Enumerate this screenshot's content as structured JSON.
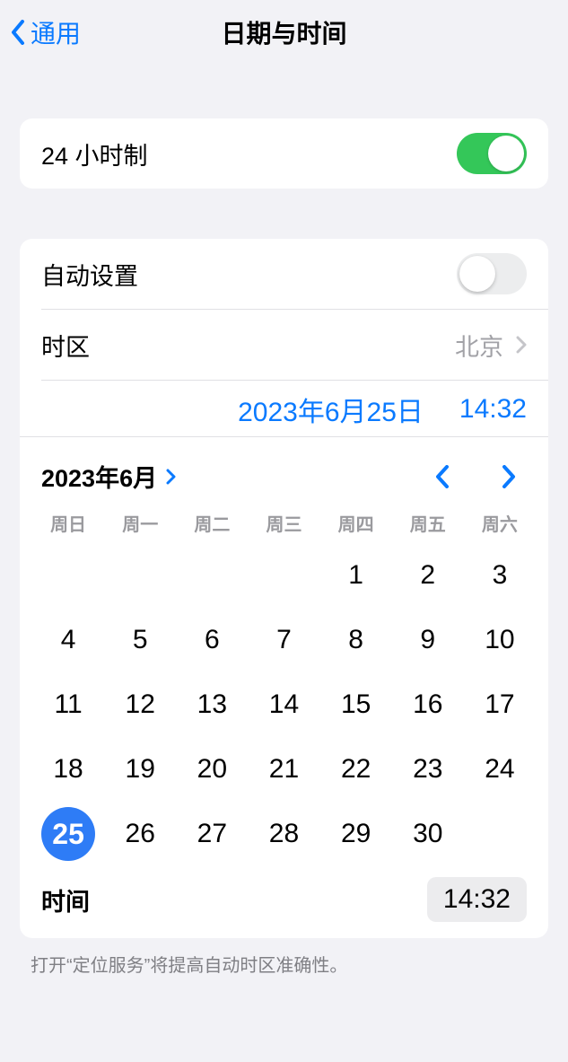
{
  "nav": {
    "back_label": "通用",
    "title": "日期与时间"
  },
  "row_24h": {
    "label": "24 小时制",
    "on": true
  },
  "row_autoset": {
    "label": "自动设置",
    "on": false
  },
  "row_timezone": {
    "label": "时区",
    "value": "北京"
  },
  "picker": {
    "date_label": "2023年6月25日",
    "time_label": "14:32"
  },
  "calendar": {
    "month_label": "2023年6月",
    "weekdays": [
      "周日",
      "周一",
      "周二",
      "周三",
      "周四",
      "周五",
      "周六"
    ],
    "leading_blanks": 4,
    "days_in_month": 30,
    "selected_day": 25
  },
  "time_row": {
    "label": "时间",
    "value": "14:32"
  },
  "footer": "打开“定位服务”将提高自动时区准确性。"
}
